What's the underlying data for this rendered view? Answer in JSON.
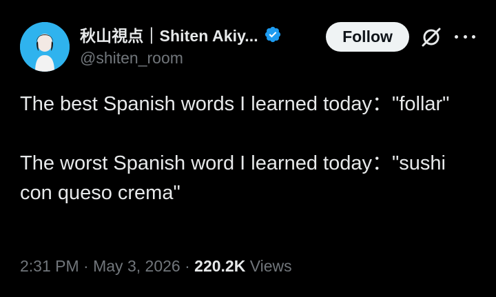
{
  "author": {
    "display_name": "秋山視点｜Shiten Akiy...",
    "handle": "@shiten_room",
    "verified": true
  },
  "actions": {
    "follow_label": "Follow",
    "grok_icon": "grok-icon",
    "more_icon": "more-icon"
  },
  "tweet": {
    "paragraphs": [
      "The best Spanish words I learned today：\"follar\"",
      "The worst Spanish word I learned today：\"sushi con queso crema\""
    ]
  },
  "meta": {
    "time": "2:31 PM",
    "separator": " · ",
    "date": "May 3, 2026",
    "views_count": "220.2K",
    "views_label": "Views"
  },
  "colors": {
    "background": "#000000",
    "text": "#e7e9ea",
    "muted": "#71767b",
    "verified": "#1d9bf0",
    "avatar_bg": "#2fb3ee"
  }
}
